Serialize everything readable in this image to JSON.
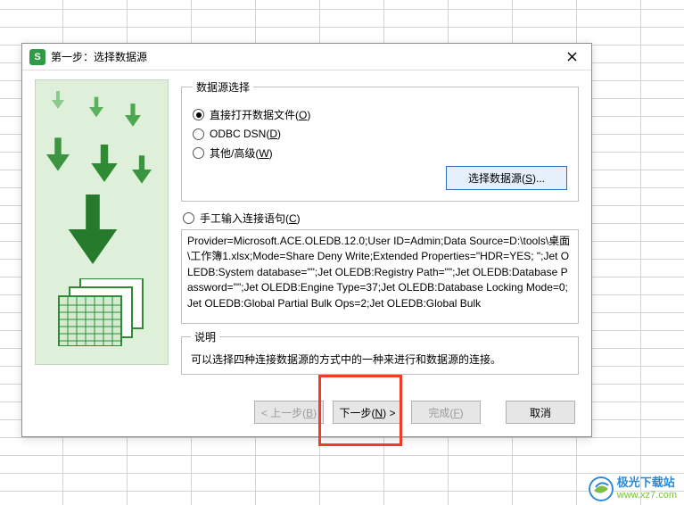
{
  "dialog": {
    "title": "第一步：选择数据源",
    "fieldset_ds_label": "数据源选择",
    "radios": {
      "direct_open": {
        "prefix": "直接打开数据文件(",
        "accel": "O",
        "suffix": ")"
      },
      "odbc": {
        "prefix": "ODBC DSN(",
        "accel": "D",
        "suffix": ")"
      },
      "other": {
        "prefix": "其他/高级(",
        "accel": "W",
        "suffix": ")"
      },
      "manual": {
        "prefix": "手工输入连接语句(",
        "accel": "C",
        "suffix": ")"
      }
    },
    "select_ds_btn": {
      "prefix": "选择数据源(",
      "accel": "S",
      "suffix": ")..."
    },
    "conn_string": "Provider=Microsoft.ACE.OLEDB.12.0;User ID=Admin;Data Source=D:\\tools\\桌面\\工作簿1.xlsx;Mode=Share Deny Write;Extended Properties=\"HDR=YES; \";Jet OLEDB:System database=\"\";Jet OLEDB:Registry Path=\"\";Jet OLEDB:Database Password=\"\";Jet OLEDB:Engine Type=37;Jet OLEDB:Database Locking Mode=0;Jet OLEDB:Global Partial Bulk Ops=2;Jet OLEDB:Global Bulk",
    "desc_legend": "说明",
    "desc_text": "可以选择四种连接数据源的方式中的一种来进行和数据源的连接。"
  },
  "buttons": {
    "back": {
      "prefix": "< 上一步(",
      "accel": "B",
      "suffix": ")"
    },
    "next": {
      "prefix": "下一步(",
      "accel": "N",
      "suffix": ") >"
    },
    "finish": {
      "prefix": "完成(",
      "accel": "F",
      "suffix": ")"
    },
    "cancel": "取消"
  },
  "watermark": {
    "line1": "极光下载站",
    "line2": "www.xz7.com"
  }
}
